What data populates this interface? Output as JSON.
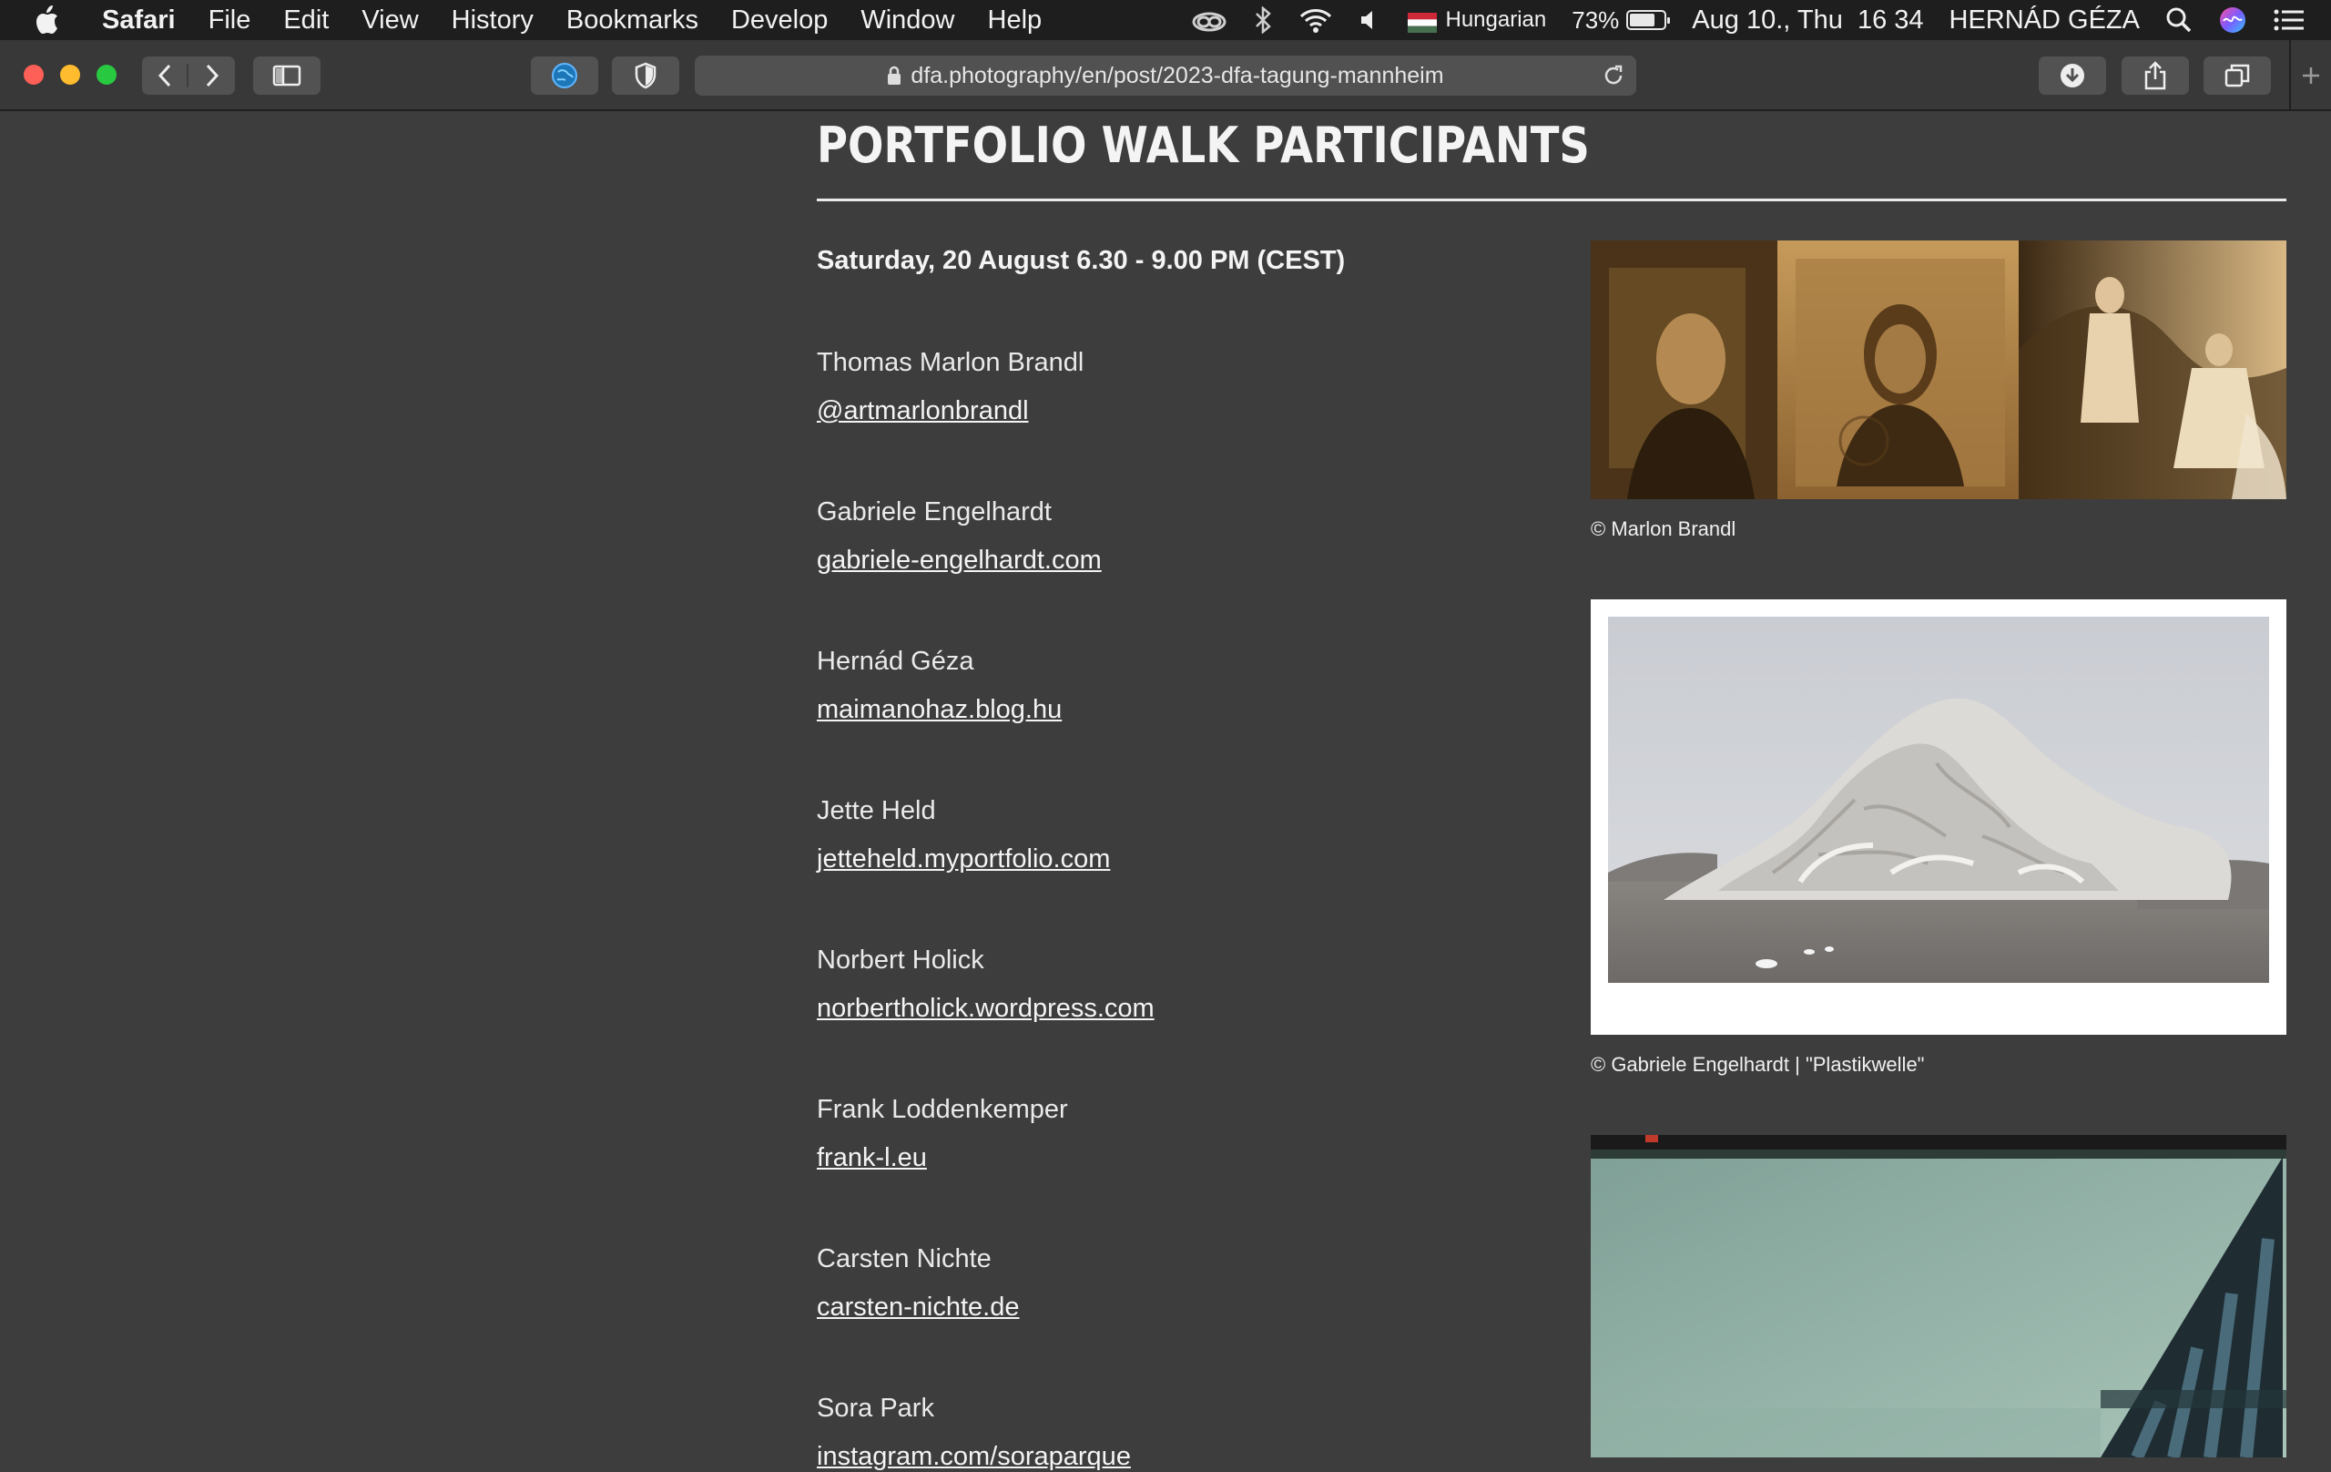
{
  "menubar": {
    "app_name": "Safari",
    "menus": [
      "File",
      "Edit",
      "View",
      "History",
      "Bookmarks",
      "Develop",
      "Window",
      "Help"
    ],
    "input_language": "Hungarian",
    "battery_percent": "73%",
    "battery_level": 0.73,
    "datetime": "Aug 10., Thu  16 34",
    "user_name": "HERNÁD GÉZA"
  },
  "browser": {
    "url": "dfa.photography/en/post/2023-dfa-tagung-mannheim"
  },
  "page": {
    "title": "PORTFOLIO WALK PARTICIPANTS",
    "event_date": "Saturday, 20 August 6.30 - 9.00 PM (CEST)",
    "participants": [
      {
        "name": "Thomas Marlon Brandl",
        "link": "@artmarlonbrandl"
      },
      {
        "name": "Gabriele Engelhardt",
        "link": "gabriele-engelhardt.com"
      },
      {
        "name": "Hernád Géza",
        "link": "maimanohaz.blog.hu"
      },
      {
        "name": "Jette Held",
        "link": "jetteheld.myportfolio.com"
      },
      {
        "name": "Norbert Holick",
        "link": "norbertholick.wordpress.com"
      },
      {
        "name": "Frank Loddenkemper",
        "link": "frank-l.eu"
      },
      {
        "name": "Carsten Nichte",
        "link": "carsten-nichte.de"
      },
      {
        "name": "Sora Park",
        "link": "instagram.com/soraparque"
      }
    ],
    "figures": [
      {
        "caption": "© Marlon Brandl"
      },
      {
        "caption": "© Gabriele Engelhardt | \"Plastikwelle\""
      },
      {
        "caption": ""
      }
    ]
  }
}
